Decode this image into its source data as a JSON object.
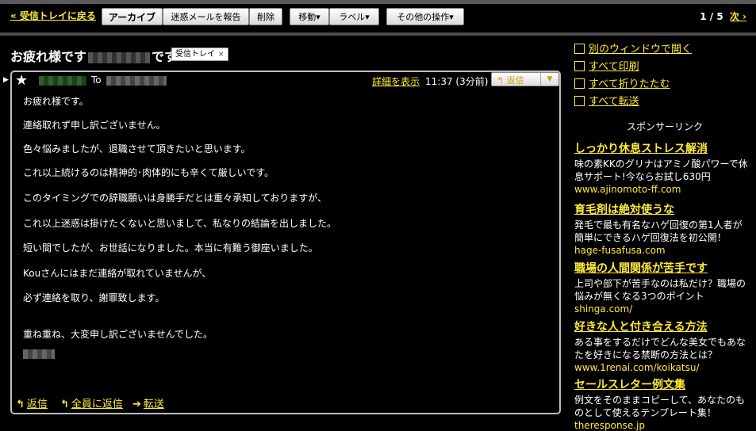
{
  "toolbar": {
    "back_link": "« 受信トレイに戻る",
    "archive": "アーカイブ",
    "report_spam": "迷惑メールを報告",
    "delete": "削除",
    "move": "移動▾",
    "labels": "ラベル▾",
    "more_actions": "その他の操作▾",
    "pager": "1 / 5",
    "next": "次 ›"
  },
  "subject": {
    "before": "お疲れ様です",
    "after": "です",
    "label_chip": "受信トレイ",
    "label_remove": "×"
  },
  "message": {
    "to_label": "To",
    "show_details": "詳細を表示",
    "time": "11:37 (3分前)",
    "reply": "返信",
    "body": [
      "お疲れ様です。",
      "連絡取れず申し訳ございません。",
      "色々悩みましたが、退職させて頂きたいと思います。",
      "これ以上続けるのは精神的･肉体的にも辛くて厳しいです。",
      "このタイミングでの辞職願いは身勝手だとは重々承知しておりますが、",
      "これ以上迷惑は掛けたくないと思いまして、私なりの結論を出しました。",
      "短い間でしたが、お世話になりました。本当に有難う御座いました。",
      "Kouさんにはまだ連絡が取れていませんが、",
      "必ず連絡を取り、謝罪致します。",
      "重ね重ね、大変申し訳ございませんでした。"
    ],
    "actions": {
      "reply": "返信",
      "reply_all": "全員に返信",
      "forward": "転送"
    }
  },
  "sidebar": {
    "open_new_window": "別のウィンドウで開く",
    "print_all": "すべて印刷",
    "collapse_all": "すべて折りたたむ",
    "forward_all": "すべて転送",
    "sponsor_title": "スポンサーリンク",
    "ads": [
      {
        "title": "しっかり休息ストレス解消",
        "desc": "味の素KKのグリナはアミノ酸パワーで休息サポート!今ならお試し630円",
        "url": "www.ajinomoto-ff.com"
      },
      {
        "title": "育毛剤は絶対使うな",
        "desc": "発毛で最も有名なハゲ回復の第1人者が簡単にできるハゲ回復法を初公開！",
        "url": "hage-fusafusa.com"
      },
      {
        "title": "職場の人間関係が苦手です",
        "desc": "上司や部下が苦手なのは私だけ？職場の悩みが無くなる3つのポイント",
        "url": "shinga.com/"
      },
      {
        "title": "好きな人と付き合える方法",
        "desc": "ある事をするだけでどんな美女でもあなたを好きになる禁断の方法とは？",
        "url": "www.1renai.com/koikatsu/"
      },
      {
        "title": "セールスレター例文集",
        "desc": "例文をそのままコピーして、あなたのものとして使えるテンプレート集！",
        "url": "theresponse.jp"
      }
    ]
  }
}
